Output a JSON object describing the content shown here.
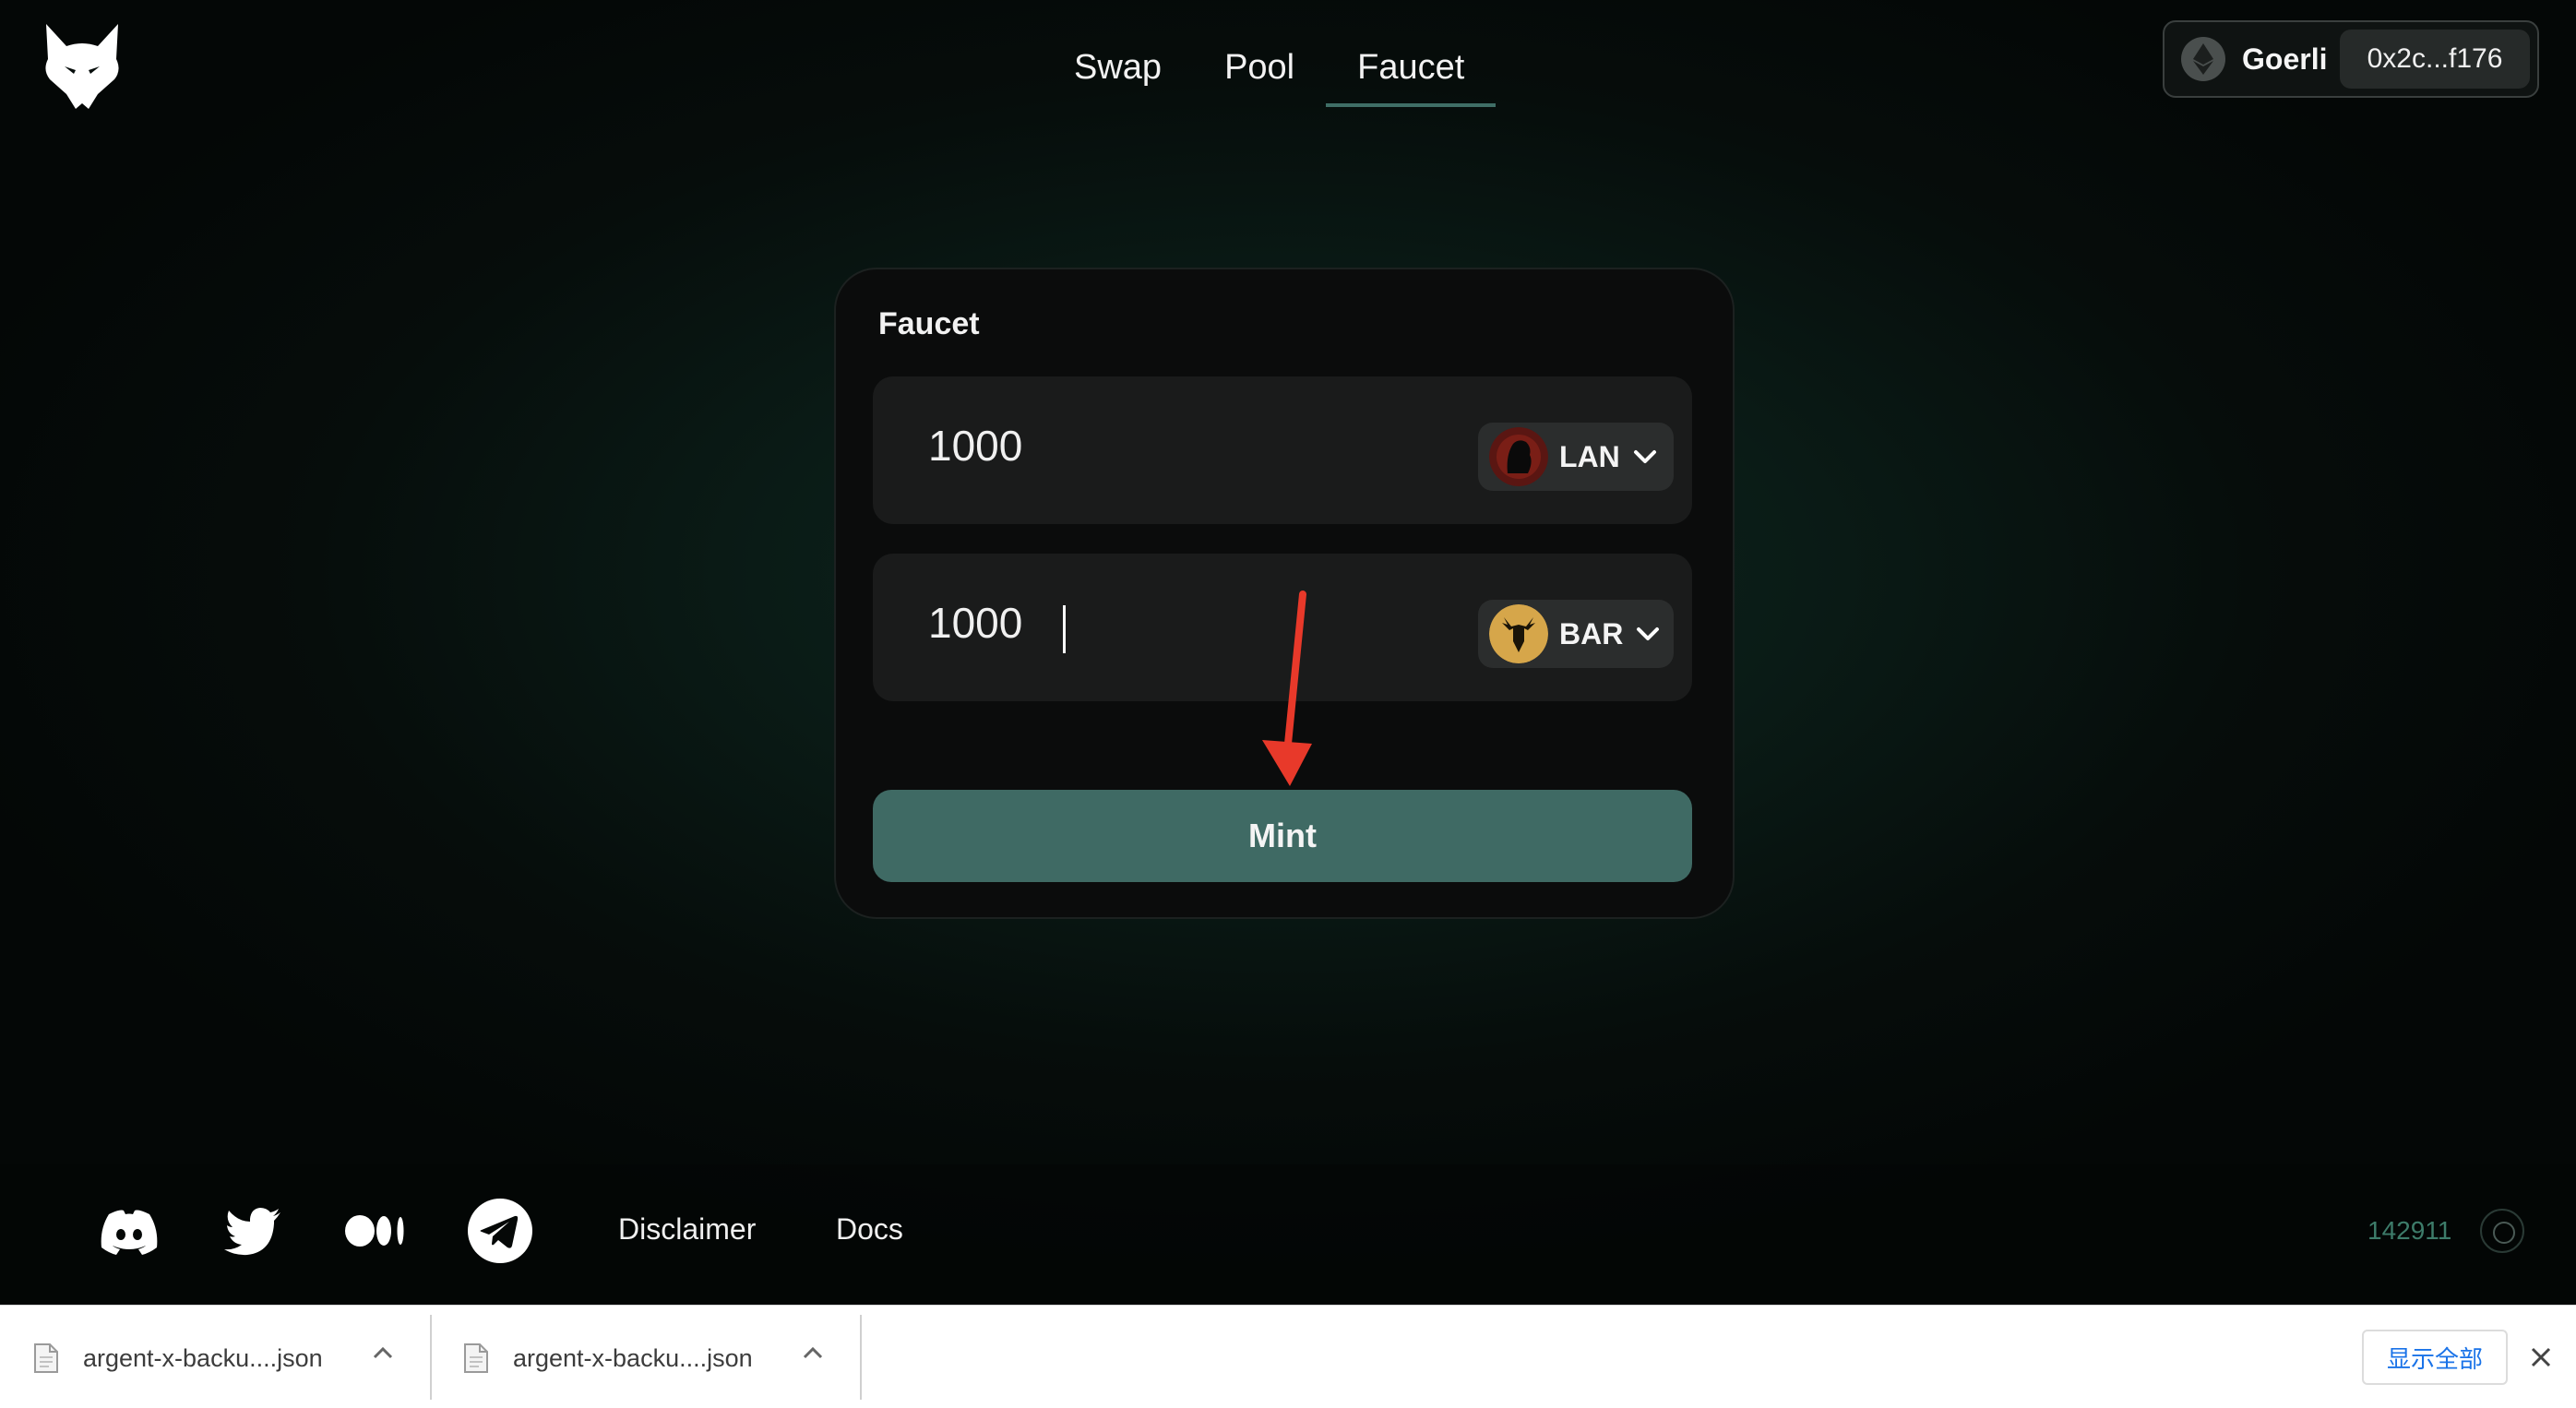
{
  "header": {
    "logo_icon": "lynx-head-logo-icon",
    "nav": [
      {
        "label": "Swap",
        "active": false
      },
      {
        "label": "Pool",
        "active": false
      },
      {
        "label": "Faucet",
        "active": true
      }
    ],
    "wallet": {
      "network_icon": "ethereum-icon",
      "network": "Goerli",
      "address": "0x2c...f176"
    }
  },
  "faucet": {
    "title": "Faucet",
    "inputs": [
      {
        "amount": "1000",
        "token": "LAN",
        "token_icon": "lan-token-icon"
      },
      {
        "amount": "1000",
        "token": "BAR",
        "token_icon": "bar-token-icon"
      }
    ],
    "mint_label": "Mint"
  },
  "footer": {
    "social": [
      "discord-icon",
      "twitter-icon",
      "medium-icon",
      "telegram-icon"
    ],
    "links": [
      "Disclaimer",
      "Docs"
    ],
    "block_number": "142911"
  },
  "downloads": {
    "items": [
      {
        "name": "argent-x-backu....json"
      },
      {
        "name": "argent-x-backu....json"
      }
    ],
    "show_all": "显示全部"
  },
  "colors": {
    "accent": "#3f6a64",
    "block_number": "#3d7c6a",
    "annotation_arrow": "#e8392a"
  }
}
